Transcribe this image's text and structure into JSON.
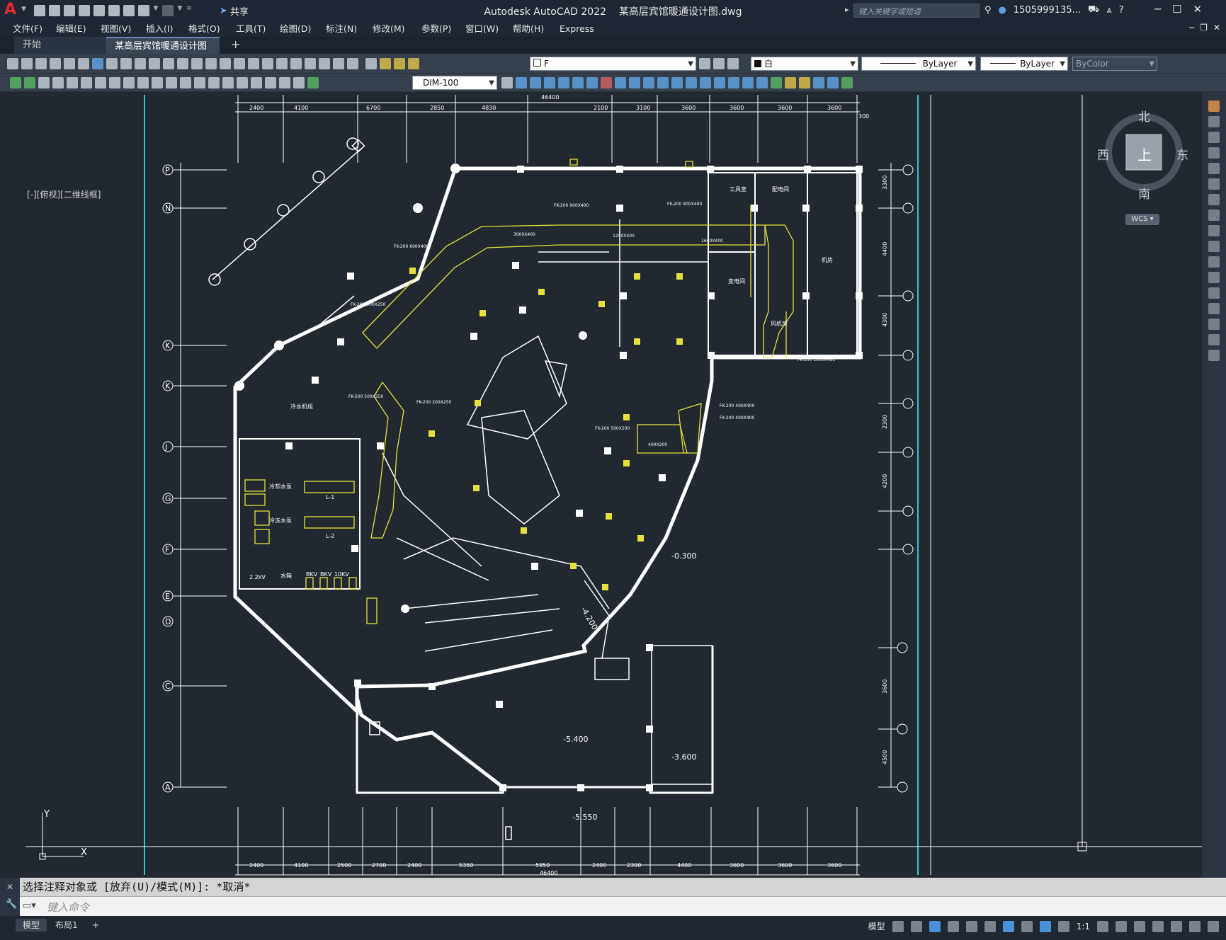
{
  "titlebar": {
    "app_title": "Autodesk AutoCAD 2022",
    "file_name": "某高层宾馆暖通设计图.dwg",
    "share_label": "共享",
    "search_placeholder": "键入关键字或短语",
    "user_name": "1505999135..."
  },
  "menubar": {
    "items": [
      "文件(F)",
      "编辑(E)",
      "视图(V)",
      "插入(I)",
      "格式(O)",
      "工具(T)",
      "绘图(D)",
      "标注(N)",
      "修改(M)",
      "参数(P)",
      "窗口(W)",
      "帮助(H)",
      "Express"
    ]
  },
  "tabs": [
    {
      "label": "开始"
    },
    {
      "label": "某高层宾馆暖通设计图*"
    }
  ],
  "toolbar": {
    "layer_name": "F",
    "color_value": "白",
    "linetype_value": "ByLayer",
    "lineweight_value": "ByLayer",
    "plotstyle_value": "ByColor",
    "dim_style": "DIM-100"
  },
  "viewport": {
    "label": "[-][俯视][二维线框]"
  },
  "viewcube": {
    "north": "北",
    "south": "南",
    "east": "东",
    "west": "西",
    "face": "上",
    "wcs": "WCS"
  },
  "drawing": {
    "top_dims": [
      "2400",
      "4100",
      "6700",
      "2850",
      "4830",
      "46400",
      "2100",
      "3100",
      "3600",
      "3600",
      "3600",
      "3600",
      "300"
    ],
    "bottom_dims": [
      "2400",
      "4100",
      "2500",
      "2700",
      "2400",
      "5350",
      "5950",
      "46400",
      "2400",
      "2300",
      "4400",
      "3600",
      "3600",
      "3600"
    ],
    "left_axes": [
      "P",
      "N",
      "K",
      "K",
      "J",
      "G",
      "F",
      "E",
      "C",
      "D",
      "A"
    ],
    "right_dims": [
      "3300",
      "4400",
      "4300",
      "2300",
      "4200",
      "3600",
      "4500"
    ],
    "elevations": [
      "-0.300",
      "-4.200",
      "-5.400",
      "-3.600",
      "-5.550"
    ],
    "room_labels": [
      "工具室",
      "配电间",
      "变电间",
      "风机房",
      "机房",
      "冷水机组",
      "L-1",
      "L-2",
      "冷却水泵",
      "冷冻水泵",
      "2.2kV",
      "水箱",
      "BKV",
      "BKV",
      "10KV"
    ],
    "duct_labels": [
      "FK-200 900X400",
      "FK-200 900X400",
      "FK-200 600X400",
      "FK-200 1000X400",
      "FK-200 500X250",
      "FK-200 200X250",
      "FK-200 500X250",
      "FK-200 400X400",
      "FK-200 400X400",
      "FK-200 500X200",
      "3000X400",
      "1250X400",
      "1600X400",
      "400X200"
    ]
  },
  "command": {
    "history": "选择注释对象或 [放弃(U)/模式(M)]: *取消*",
    "placeholder": "键入命令"
  },
  "statusbar": {
    "layouts": [
      "模型",
      "布局1"
    ],
    "model_label": "模型",
    "scale": "1:1"
  },
  "colors": {
    "canvas": "#212830",
    "duct": "#e6e03c",
    "wall": "#ffffff",
    "axis_line": "#2ec7d4"
  }
}
